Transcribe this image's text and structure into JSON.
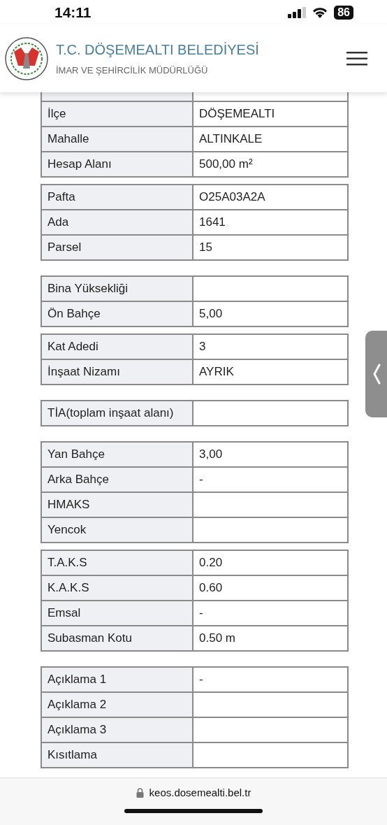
{
  "status_bar": {
    "time": "14:11",
    "battery": "86"
  },
  "header": {
    "title": "T.C. DÖŞEMEALTI BELEDİYESİ",
    "subtitle": "İMAR VE ŞEHİRCİLİK MÜDÜRLÜĞÜ"
  },
  "groups": [
    {
      "rows": [
        {
          "label": "İlçe",
          "value": "DÖŞEMEALTI"
        },
        {
          "label": "Mahalle",
          "value": "ALTINKALE"
        },
        {
          "label": "Hesap Alanı",
          "value": "500,00 m²"
        }
      ]
    },
    {
      "rows": [
        {
          "label": "Pafta",
          "value": "O25A03A2A"
        },
        {
          "label": "Ada",
          "value": "1641"
        },
        {
          "label": "Parsel",
          "value": "15"
        }
      ]
    },
    {
      "rows": [
        {
          "label": "Bina Yüksekliği"
        },
        {
          "label": "Ön Bahçe",
          "value": "5,00"
        }
      ]
    },
    {
      "rows": [
        {
          "label": "Kat Adedi",
          "value": "3"
        },
        {
          "label": "İnşaat Nizamı",
          "value": "AYRIK"
        }
      ]
    },
    {
      "rows": [
        {
          "label": "TİA(toplam inşaat alanı)"
        }
      ]
    },
    {
      "rows": [
        {
          "label": "Yan Bahçe",
          "value": "3,00"
        },
        {
          "label": "Arka Bahçe",
          "value": "-"
        },
        {
          "label": "HMAKS"
        },
        {
          "label": "Yencok"
        }
      ]
    },
    {
      "rows": [
        {
          "label": "T.A.K.S",
          "value": "0.20"
        },
        {
          "label": "K.A.K.S",
          "value": "0.60"
        },
        {
          "label": "Emsal",
          "value": "-"
        },
        {
          "label": "Subasman Kotu",
          "value": "0.50 m"
        }
      ]
    },
    {
      "rows": [
        {
          "label": "Açıklama 1",
          "value": "-"
        },
        {
          "label": "Açıklama 2"
        },
        {
          "label": "Açıklama 3"
        },
        {
          "label": "Kısıtlama"
        }
      ]
    }
  ],
  "browser": {
    "url": "keos.dosemealti.bel.tr"
  }
}
